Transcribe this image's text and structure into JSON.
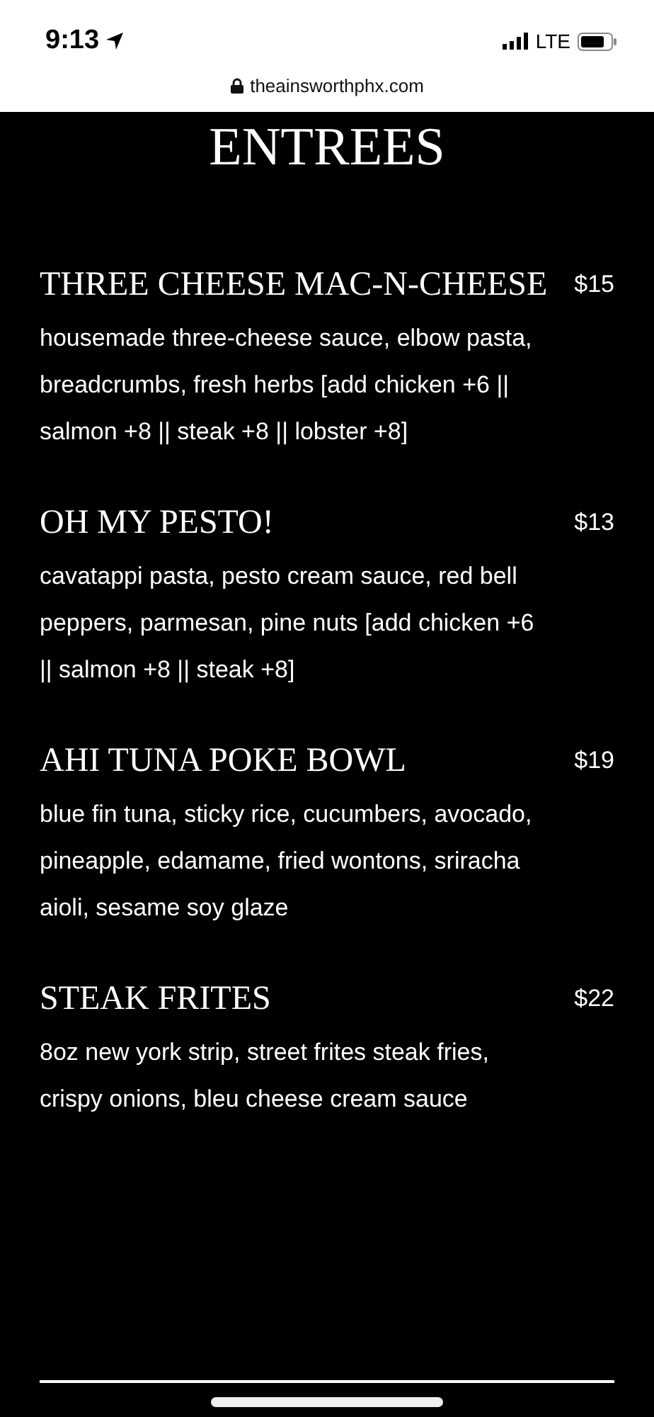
{
  "status_bar": {
    "time": "9:13",
    "network": "LTE"
  },
  "address_bar": {
    "url": "theainsworthphx.com"
  },
  "menu": {
    "title": "ENTREES",
    "items": [
      {
        "name": "THREE CHEESE MAC-N-CHEESE",
        "price": "$15",
        "description": "housemade three-cheese sauce, elbow pasta, breadcrumbs, fresh herbs [add chicken +6 || salmon +8 || steak +8 || lobster +8]"
      },
      {
        "name": "OH MY PESTO!",
        "price": "$13",
        "description": "cavatappi pasta, pesto cream sauce, red bell peppers, parmesan, pine nuts [add chicken +6 || salmon +8 || steak +8]"
      },
      {
        "name": "AHI TUNA POKE BOWL",
        "price": "$19",
        "description": "blue fin tuna, sticky rice, cucumbers, avocado, pineapple, edamame, fried wontons, sriracha aioli, sesame soy glaze"
      },
      {
        "name": "STEAK FRITES",
        "price": "$22",
        "description": "8oz new york strip, street frites steak fries, crispy onions, bleu cheese cream sauce"
      }
    ]
  }
}
